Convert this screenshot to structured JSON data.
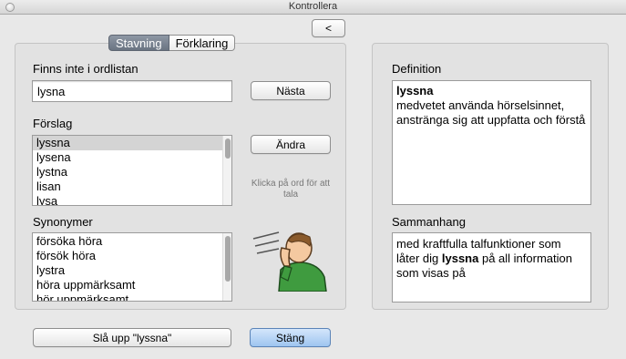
{
  "window": {
    "title": "Kontrollera"
  },
  "back_button": {
    "label": "<"
  },
  "tabs": [
    {
      "label": "Stavning",
      "active": true
    },
    {
      "label": "Förklaring",
      "active": false
    }
  ],
  "spelling": {
    "not_in_dictionary_label": "Finns inte i ordlistan",
    "word_value": "lysna",
    "next_button": "Nästa",
    "suggestions_label": "Förslag",
    "suggestions": [
      "lyssna",
      "lysena",
      "lystna",
      "lisan",
      "lysa"
    ],
    "selected_suggestion": "lyssna",
    "change_button": "Ändra",
    "hint": "Klicka på ord för att tala",
    "synonyms_label": "Synonymer",
    "synonyms": [
      "försöka höra",
      "försök höra",
      "lystra",
      "höra uppmärksamt",
      "hör uppmärksamt"
    ]
  },
  "definition": {
    "label": "Definition",
    "headword": "lyssna",
    "text": "medvetet använda hörselsinnet, anstränga sig att uppfatta och förstå"
  },
  "context": {
    "label": "Sammanhang",
    "before": "med kraftfulla talfunktioner som låter dig ",
    "highlight": "lyssna",
    "after": " på all information som visas på"
  },
  "bottom": {
    "lookup_button": "Slå upp \"lyssna\"",
    "close_button": "Stäng"
  },
  "colors": {
    "accent": "#9ec5f0",
    "tab_active": "#6a7482",
    "listening_person_shirt": "#3f9b3f",
    "skin": "#f4c9a0"
  },
  "icons": {
    "listening_person": "person-listening-icon",
    "window_close": "close-icon"
  }
}
